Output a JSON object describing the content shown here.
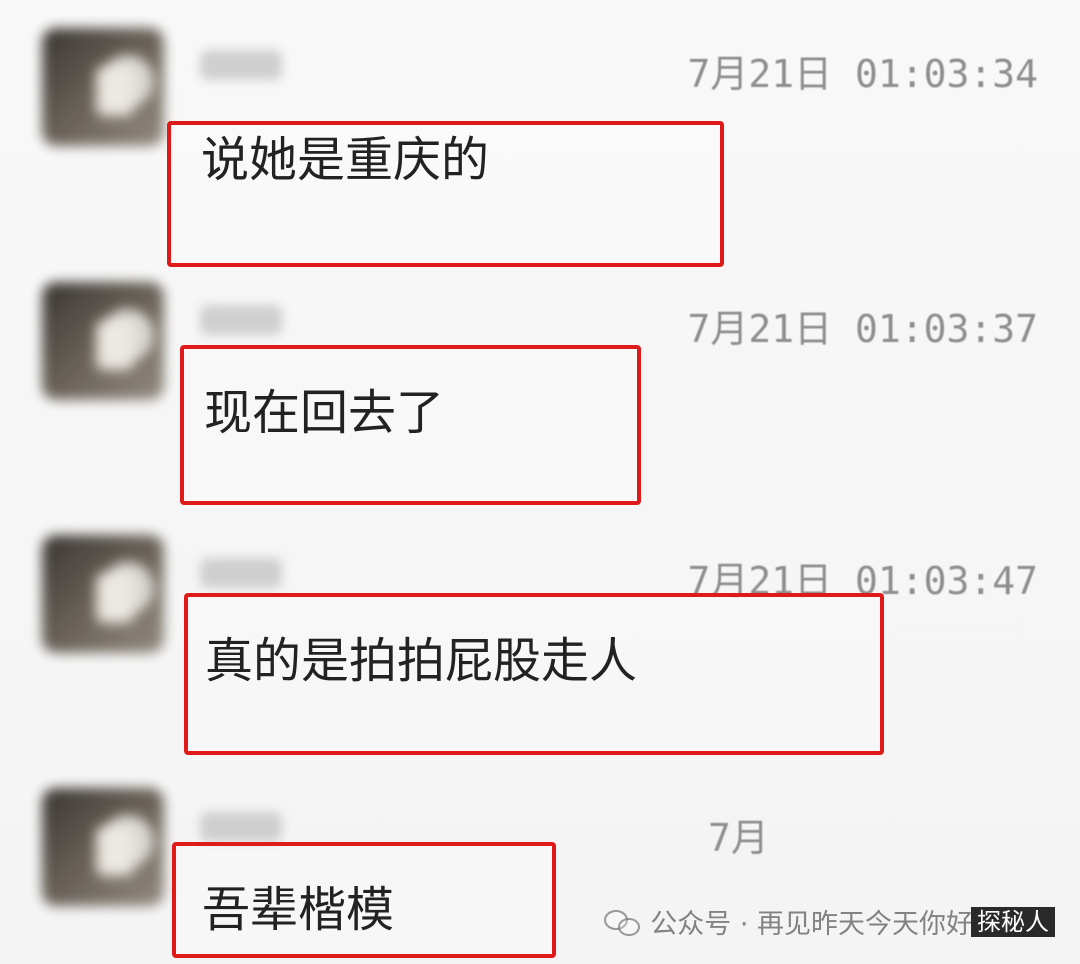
{
  "messages": [
    {
      "timestamp": "7月21日 01:03:34",
      "text": "说她是重庆的"
    },
    {
      "timestamp": "7月21日 01:03:37",
      "text": "现在回去了"
    },
    {
      "timestamp": "7月21日 01:03:47",
      "text": "真的是拍拍屁股走人"
    },
    {
      "timestamp": "7月",
      "text": "吾辈楷模"
    }
  ],
  "watermark": {
    "label": "公众号 · 再见昨天今天你好",
    "dark_label": "探秘人",
    "icon": "wechat-icon"
  },
  "colors": {
    "highlight": "#e01919",
    "timestamp": "#8f8f8f",
    "text": "#222222"
  }
}
